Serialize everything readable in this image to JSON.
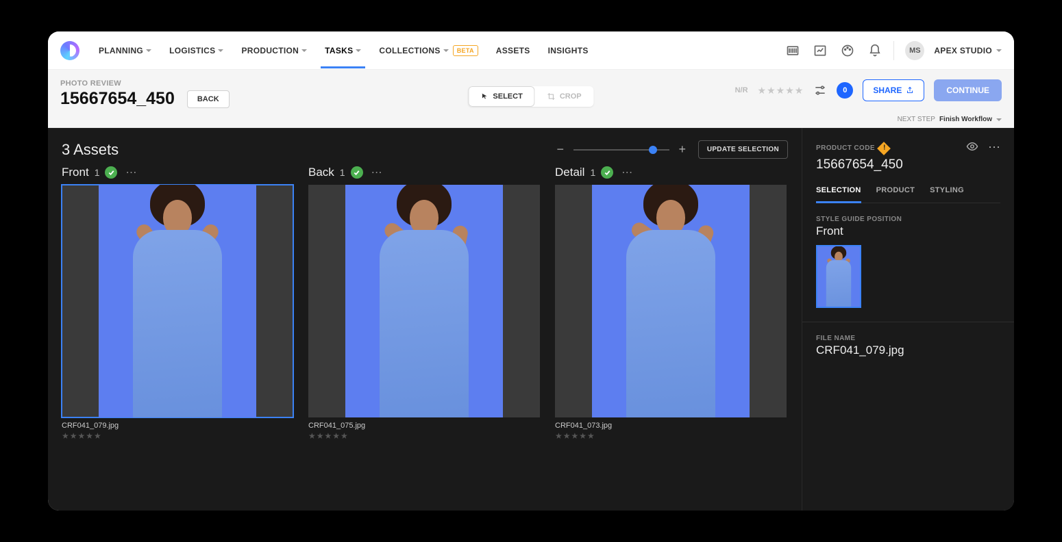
{
  "nav": {
    "items": [
      {
        "label": "PLANNING",
        "caret": true
      },
      {
        "label": "LOGISTICS",
        "caret": true
      },
      {
        "label": "PRODUCTION",
        "caret": true
      },
      {
        "label": "TASKS",
        "caret": true,
        "active": true
      },
      {
        "label": "COLLECTIONS",
        "caret": true,
        "badge": "BETA"
      },
      {
        "label": "ASSETS",
        "caret": false
      },
      {
        "label": "INSIGHTS",
        "caret": false
      }
    ],
    "avatar": "MS",
    "studio": "APEX STUDIO"
  },
  "subheader": {
    "breadcrumb": "PHOTO REVIEW",
    "title": "15667654_450",
    "back": "BACK",
    "segments": {
      "select": "SELECT",
      "crop": "CROP"
    },
    "rating_prefix": "N/R",
    "badge_count": "0",
    "share": "SHARE",
    "continue": "CONTINUE",
    "nextstep_label": "NEXT STEP",
    "nextstep_value": "Finish Workflow"
  },
  "gallery": {
    "title": "3 Assets",
    "update": "UPDATE SELECTION",
    "cards": [
      {
        "title": "Front",
        "count": "1",
        "file": "CRF041_079.jpg",
        "selected": true
      },
      {
        "title": "Back",
        "count": "1",
        "file": "CRF041_075.jpg",
        "selected": false
      },
      {
        "title": "Detail",
        "count": "1",
        "file": "CRF041_073.jpg",
        "selected": false
      }
    ]
  },
  "rpanel": {
    "pcode_label": "PRODUCT CODE",
    "pcode_value": "15667654_450",
    "tabs": [
      "SELECTION",
      "PRODUCT",
      "STYLING"
    ],
    "position_label": "STYLE GUIDE POSITION",
    "position_value": "Front",
    "filename_label": "FILE NAME",
    "filename_value": "CRF041_079.jpg"
  }
}
